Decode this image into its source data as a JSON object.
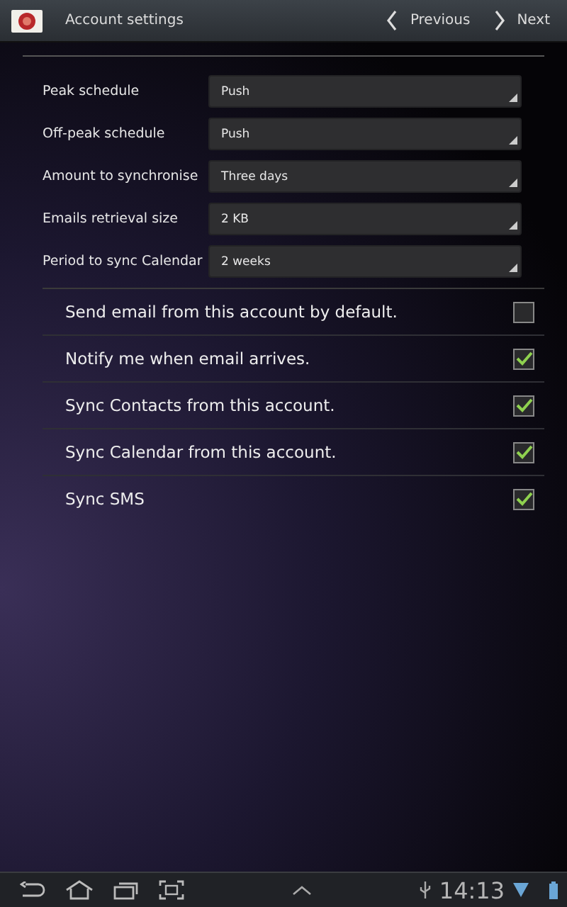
{
  "action_bar": {
    "title": "Account settings",
    "previous": "Previous",
    "next": "Next"
  },
  "dropdowns": [
    {
      "label": "Peak schedule",
      "value": "Push"
    },
    {
      "label": "Off-peak schedule",
      "value": "Push"
    },
    {
      "label": "Amount to synchronise",
      "value": "Three days"
    },
    {
      "label": "Emails retrieval size",
      "value": "2 KB"
    },
    {
      "label": "Period to sync Calendar",
      "value": "2 weeks"
    }
  ],
  "checkboxes": [
    {
      "label": "Send email from this account by default.",
      "checked": false
    },
    {
      "label": "Notify me when email arrives.",
      "checked": true
    },
    {
      "label": "Sync Contacts from this account.",
      "checked": true
    },
    {
      "label": "Sync Calendar from this account.",
      "checked": true
    },
    {
      "label": "Sync SMS",
      "checked": true
    }
  ],
  "status_bar": {
    "time": "14:13"
  }
}
